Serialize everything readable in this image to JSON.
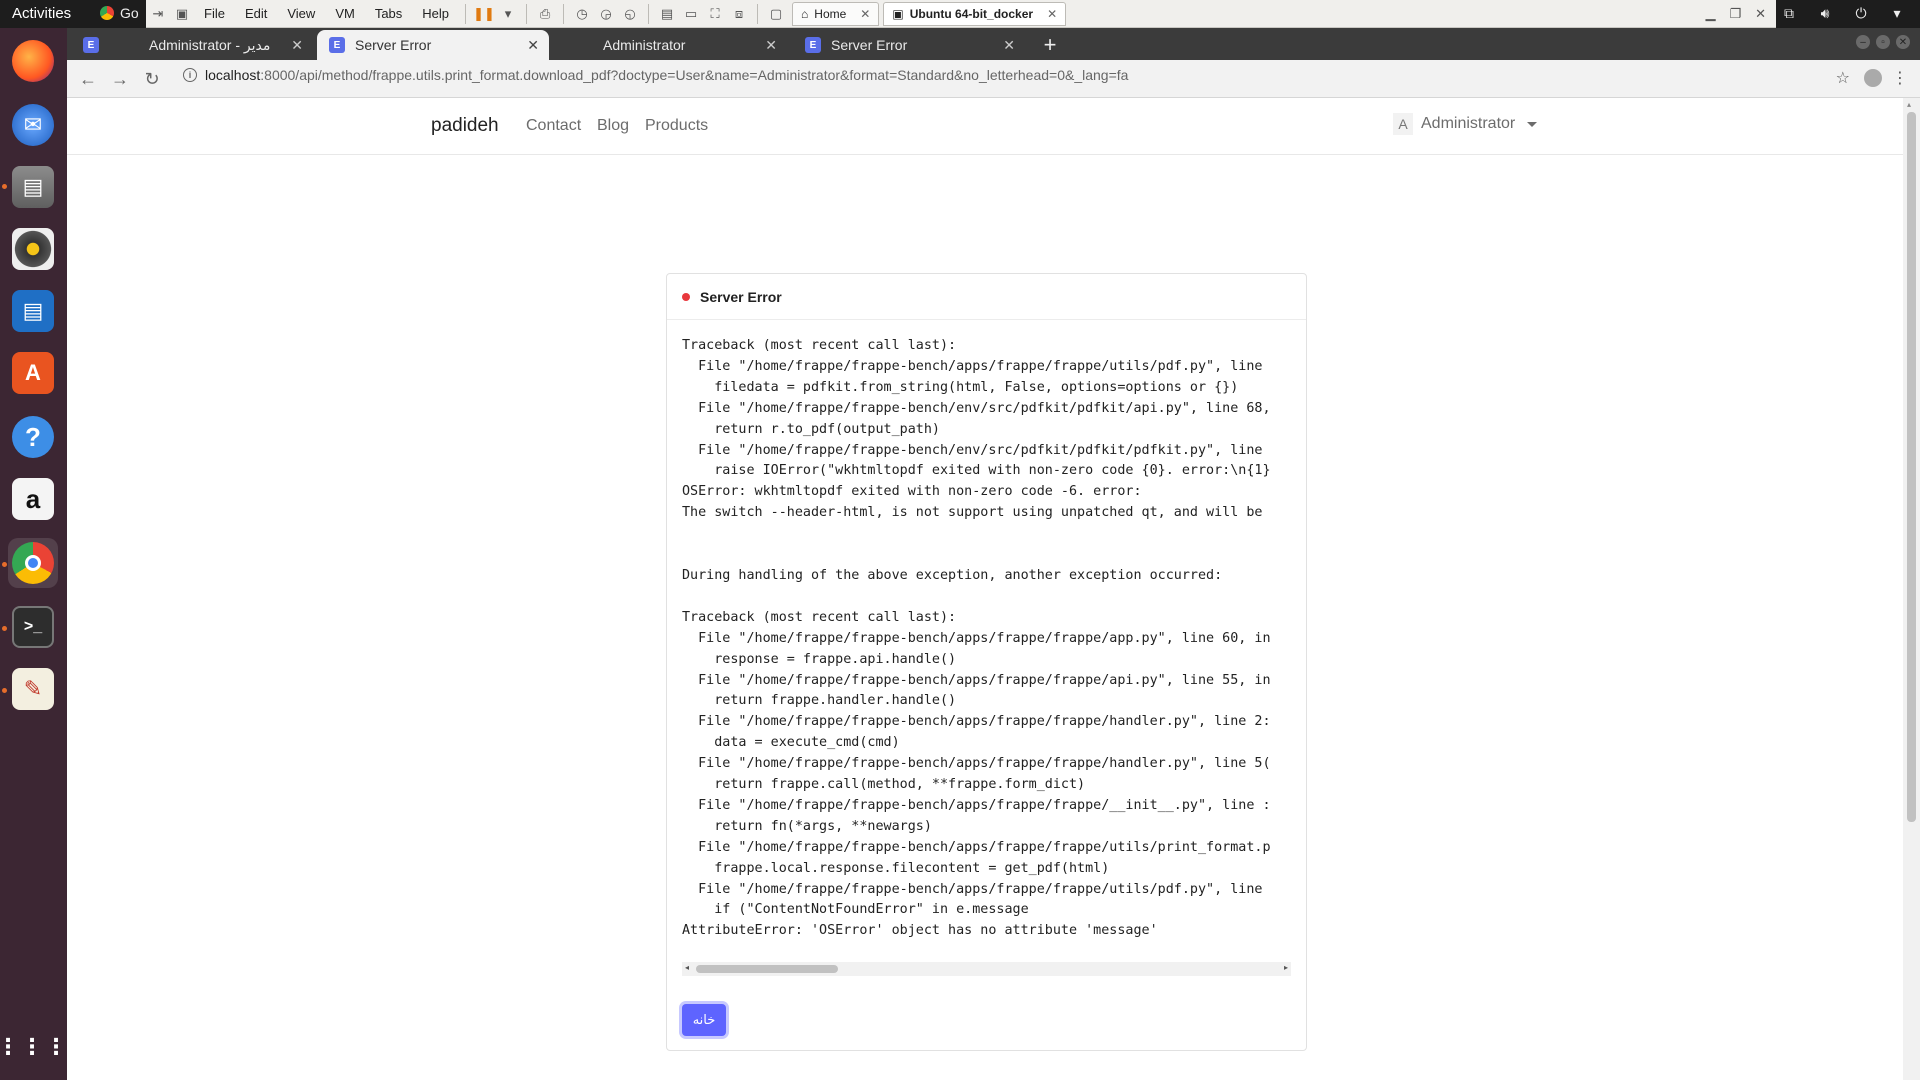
{
  "topbar": {
    "activities": "Activities",
    "app_name": "Go"
  },
  "vmware": {
    "menus": [
      "File",
      "Edit",
      "View",
      "VM",
      "Tabs",
      "Help"
    ],
    "tabs": [
      {
        "label": "Home"
      },
      {
        "label": "Ubuntu 64-bit_docker"
      }
    ]
  },
  "browser": {
    "tabs": [
      {
        "label": "Administrator - مدیر",
        "favicon": "E"
      },
      {
        "label": "Server Error",
        "favicon": "E"
      },
      {
        "label": "Administrator",
        "favicon": ""
      },
      {
        "label": "Server Error",
        "favicon": "E"
      }
    ],
    "new_tab": "+",
    "url_host": "localhost",
    "url_rest": ":8000/api/method/frappe.utils.print_format.download_pdf?doctype=User&name=Administrator&format=Standard&no_letterhead=0&_lang=fa"
  },
  "site": {
    "brand": "padideh",
    "nav": [
      "Contact",
      "Blog",
      "Products"
    ],
    "user_avatar": "A",
    "user_name": "Administrator"
  },
  "error": {
    "title": "Server Error",
    "traceback": "Traceback (most recent call last):\n  File \"/home/frappe/frappe-bench/apps/frappe/frappe/utils/pdf.py\", line\n    filedata = pdfkit.from_string(html, False, options=options or {})\n  File \"/home/frappe/frappe-bench/env/src/pdfkit/pdfkit/api.py\", line 68,\n    return r.to_pdf(output_path)\n  File \"/home/frappe/frappe-bench/env/src/pdfkit/pdfkit/pdfkit.py\", line\n    raise IOError(\"wkhtmltopdf exited with non-zero code {0}. error:\\n{1}\nOSError: wkhtmltopdf exited with non-zero code -6. error:\nThe switch --header-html, is not support using unpatched qt, and will be\n\n\nDuring handling of the above exception, another exception occurred:\n\nTraceback (most recent call last):\n  File \"/home/frappe/frappe-bench/apps/frappe/frappe/app.py\", line 60, in\n    response = frappe.api.handle()\n  File \"/home/frappe/frappe-bench/apps/frappe/frappe/api.py\", line 55, in\n    return frappe.handler.handle()\n  File \"/home/frappe/frappe-bench/apps/frappe/frappe/handler.py\", line 2:\n    data = execute_cmd(cmd)\n  File \"/home/frappe/frappe-bench/apps/frappe/frappe/handler.py\", line 5(\n    return frappe.call(method, **frappe.form_dict)\n  File \"/home/frappe/frappe-bench/apps/frappe/frappe/__init__.py\", line :\n    return fn(*args, **newargs)\n  File \"/home/frappe/frappe-bench/apps/frappe/frappe/utils/print_format.p\n    frappe.local.response.filecontent = get_pdf(html)\n  File \"/home/frappe/frappe-bench/apps/frappe/frappe/utils/pdf.py\", line\n    if (\"ContentNotFoundError\" in e.message\nAttributeError: 'OSError' object has no attribute 'message'",
    "home_button": "خانه"
  },
  "colors": {
    "primary": "#5e64ff",
    "error_dot": "#e8383d",
    "dock_bg": "#3c2633"
  }
}
